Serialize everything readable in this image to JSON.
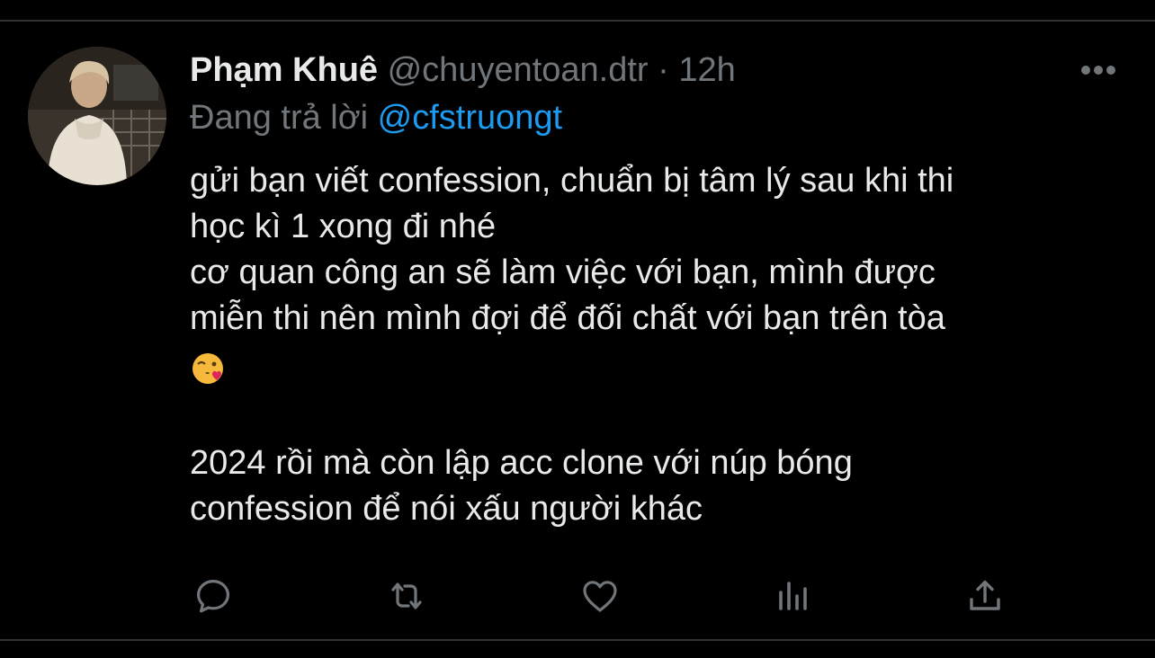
{
  "tweet": {
    "display_name": "Phạm Khuê",
    "handle": "@chuyentoan.dtr",
    "separator": "·",
    "time": "12h",
    "replying_prefix": "Đang trả lời",
    "replying_to": "@cfstruongt",
    "body": {
      "line1": "gửi bạn viết confession, chuẩn bị tâm lý sau khi thi",
      "line2": "học kì 1 xong đi nhé",
      "line3": "cơ quan công an sẽ làm việc với bạn, mình được",
      "line4": "miễn thi nên mình đợi để đối chất với bạn trên tòa",
      "emoji": "😘",
      "line5": "2024 rồi mà còn lập acc clone với núp bóng",
      "line6": "confession để nói xấu người khác"
    }
  },
  "actions": [
    {
      "icon": "reply-icon"
    },
    {
      "icon": "retweet-icon"
    },
    {
      "icon": "like-icon"
    },
    {
      "icon": "analytics-icon"
    },
    {
      "icon": "share-icon"
    }
  ],
  "colors": {
    "background": "#000000",
    "text_primary": "#e7e9ea",
    "text_secondary": "#71767b",
    "link": "#1d9bf0",
    "divider": "#2f3336"
  }
}
